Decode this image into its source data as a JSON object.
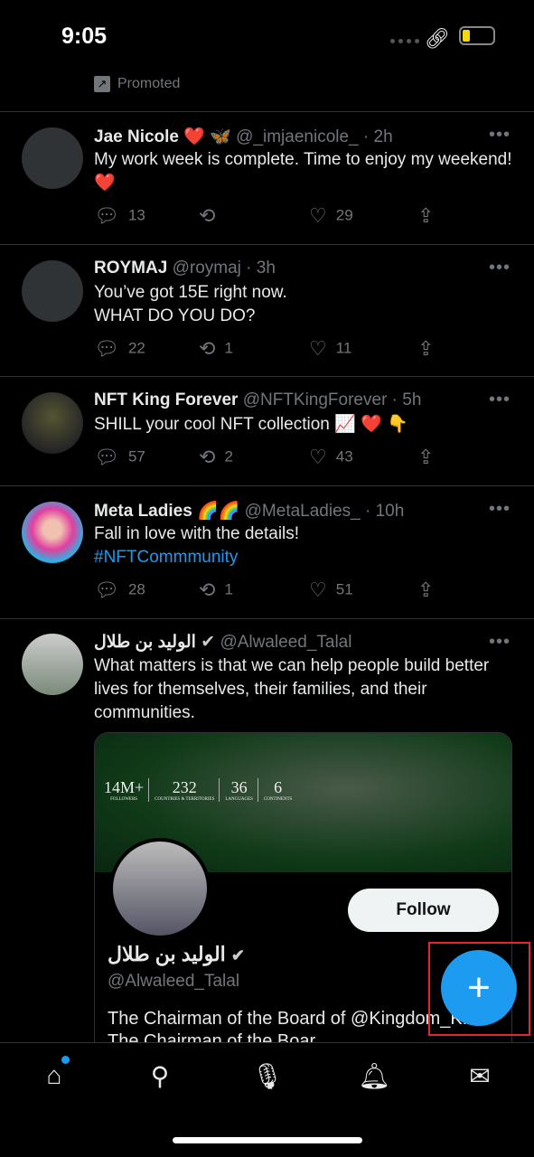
{
  "status": {
    "time": "9:05"
  },
  "promoted": "Promoted",
  "tweets": [
    {
      "name": "Jae Nicole ❤️ 🦋",
      "handle": "@_imjaenicole_ · 2h",
      "text": "My work week is complete. Time to enjoy my weekend! ❤️",
      "replies": "13",
      "retweets": "",
      "likes": "29"
    },
    {
      "name": "ROYMAJ",
      "handle": "@roymaj · 3h",
      "text": "You’ve got 15E right now.\nWHAT DO YOU DO?",
      "replies": "22",
      "retweets": "1",
      "likes": "11"
    },
    {
      "name": "NFT King Forever",
      "handle": "@NFTKingForever · 5h",
      "text": "SHILL your cool NFT collection 📈 ❤️ 👇",
      "replies": "57",
      "retweets": "2",
      "likes": "43"
    },
    {
      "name": "Meta Ladies 🌈🌈",
      "handle": "@MetaLadies_ · 10h",
      "text": "Fall in love with the details!",
      "hashtag": "#NFTCommmunity",
      "replies": "28",
      "retweets": "1",
      "likes": "51"
    },
    {
      "name": "الوليد بن طلال",
      "verified": true,
      "handle": "@Alwaleed_Talal",
      "text": "What matters is that we can help people build better lives for themselves, their families, and their communities."
    }
  ],
  "card": {
    "stats": [
      {
        "n": "14M+",
        "l": "FOLLOWERS"
      },
      {
        "n": "232",
        "l": "COUNTRIES & TERRITORIES"
      },
      {
        "n": "36",
        "l": "LANGUAGES"
      },
      {
        "n": "6",
        "l": "CONTINENTS"
      }
    ],
    "name": "الوليد بن طلال",
    "handle": "@Alwaleed_Talal",
    "bio": "The Chairman of the Board of @Kingdom_KHC The Chairman of the Boar",
    "follow": "Follow"
  },
  "fab": "+",
  "colors": {
    "accent": "#1d9bf0",
    "highlight": "#e0282e"
  }
}
